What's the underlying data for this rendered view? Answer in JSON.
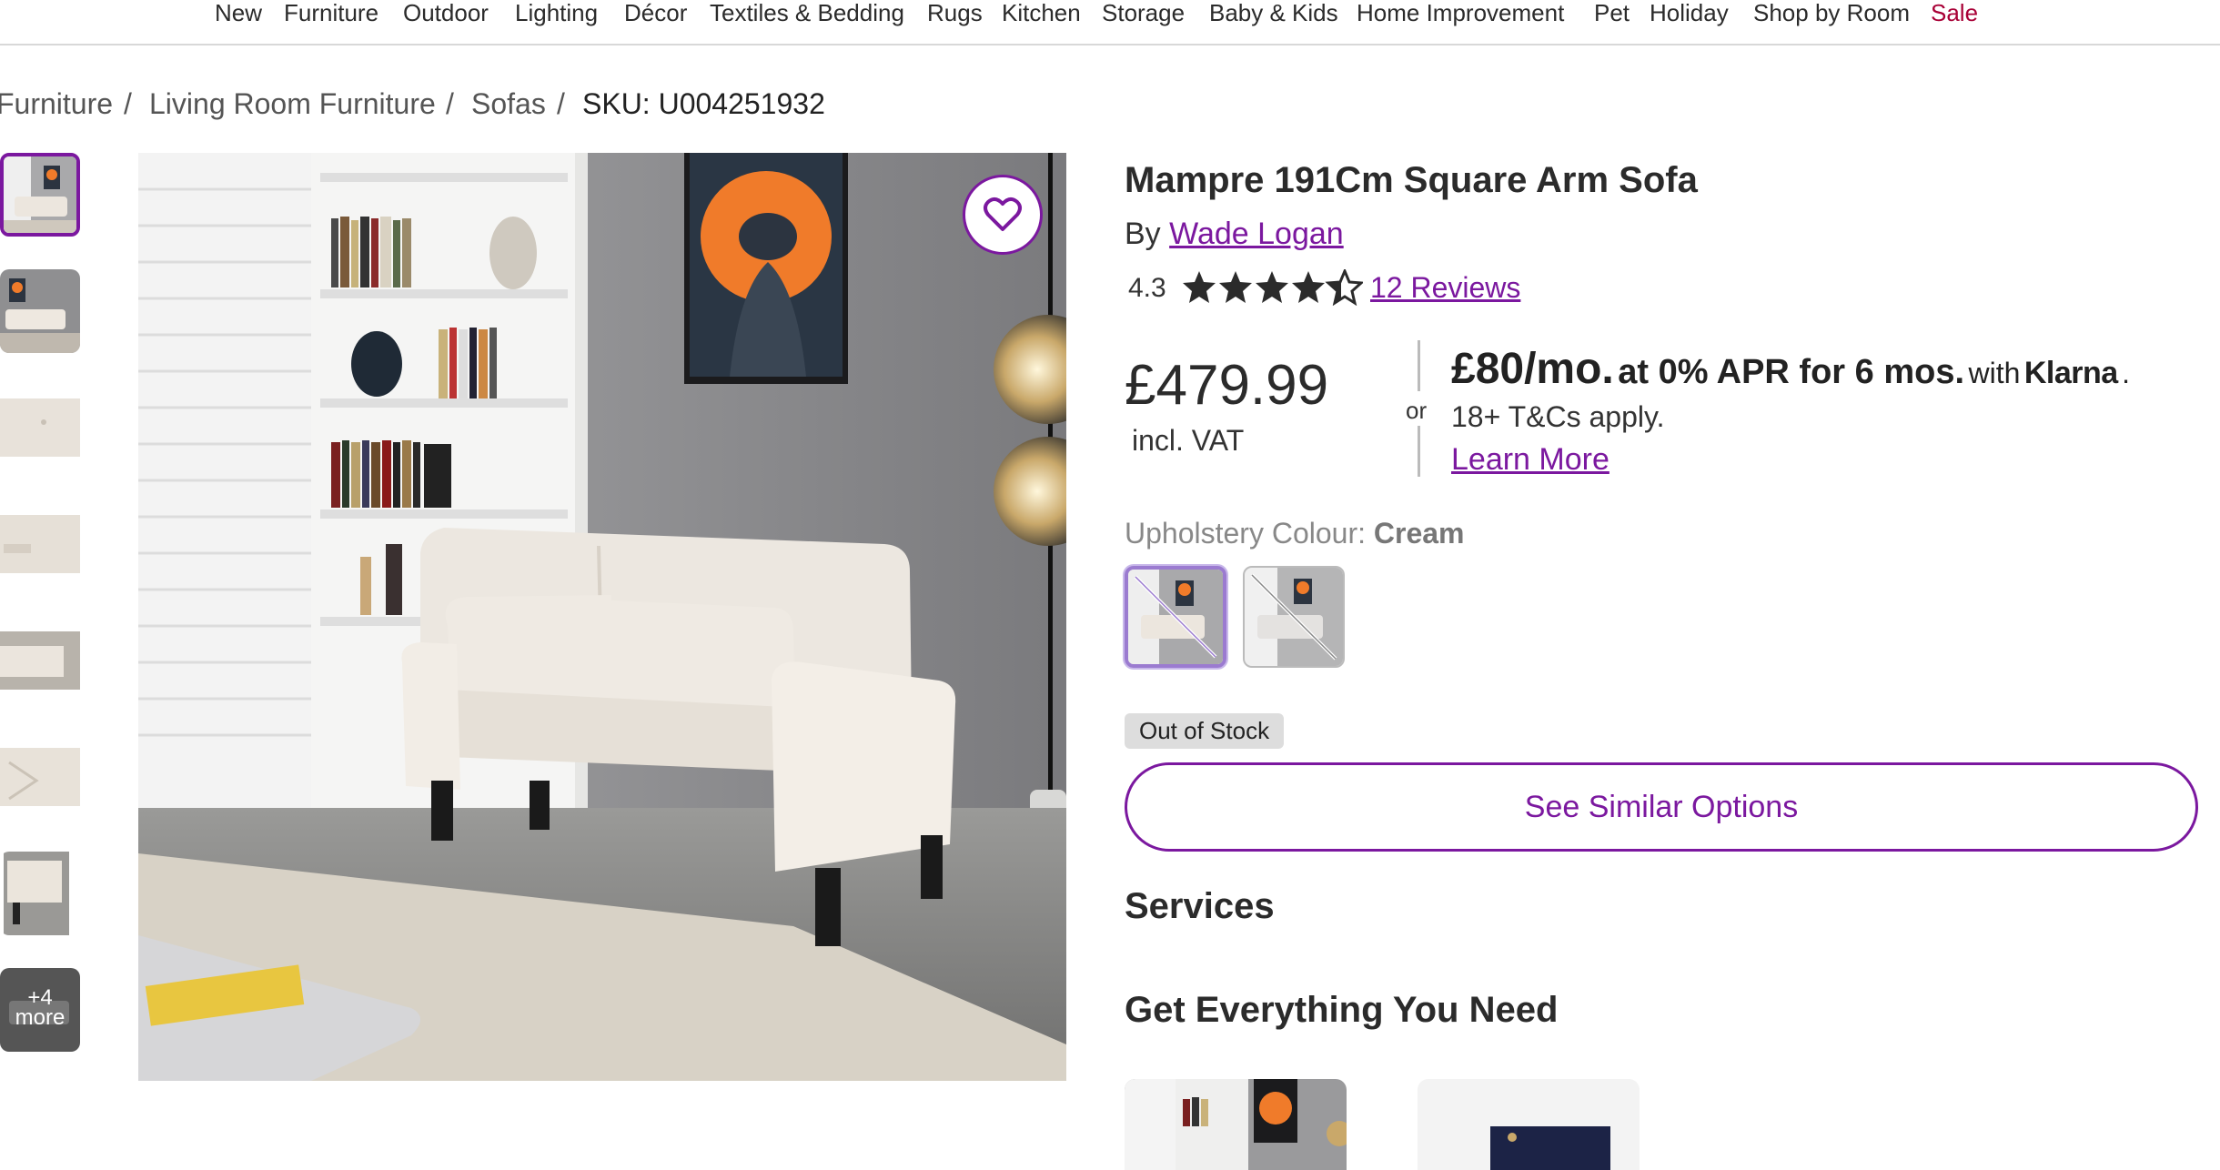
{
  "nav": {
    "items": [
      "New",
      "Furniture",
      "Outdoor",
      "Lighting",
      "Décor",
      "Textiles & Bedding",
      "Rugs",
      "Kitchen",
      "Storage",
      "Baby & Kids",
      "Home Improvement",
      "Pet",
      "Holiday",
      "Shop by Room"
    ],
    "sale": "Sale"
  },
  "breadcrumb": {
    "items": [
      "Furniture",
      "Living Room Furniture",
      "Sofas"
    ],
    "separator": "/",
    "sku": "SKU: U004251932"
  },
  "gallery": {
    "more_count": "+4",
    "more_label": "more"
  },
  "product": {
    "title": "Mampre 191Cm Square Arm Sofa",
    "by_prefix": "By",
    "brand": "Wade Logan",
    "rating": "4.3",
    "rating_value": 4.3,
    "rating_max": 5,
    "reviews": "12 Reviews"
  },
  "pricing": {
    "price": "£479.99",
    "vat": "incl. VAT",
    "or": "or",
    "monthly": "£80/mo.",
    "apr_text": "at 0% APR for 6 mos.",
    "with": "with",
    "klarna": "Klarna",
    "period": ".",
    "terms": "18+ T&Cs apply.",
    "learn_more": "Learn More"
  },
  "options": {
    "colour_label": "Upholstery Colour:",
    "colour_value": "Cream"
  },
  "stock": {
    "status": "Out of Stock",
    "similar_button": "See Similar Options"
  },
  "sections": {
    "services": "Services",
    "get_everything": "Get Everything You Need"
  },
  "colors": {
    "accent": "#7b189f",
    "sale": "#a80036"
  }
}
